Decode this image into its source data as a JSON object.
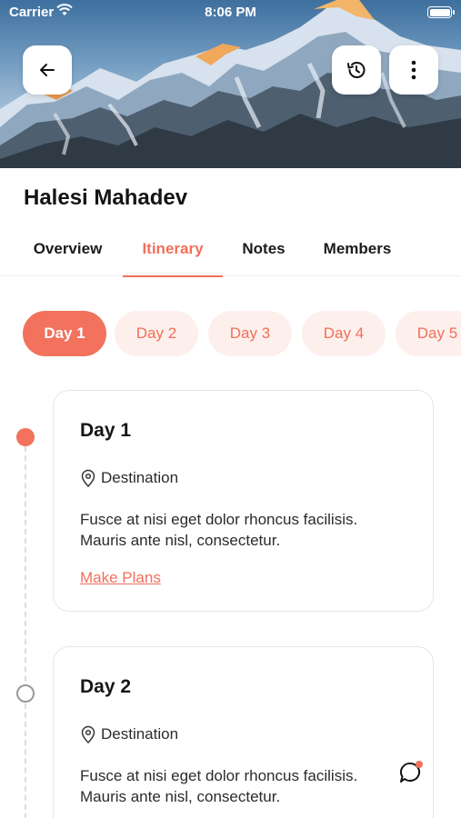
{
  "status_bar": {
    "carrier": "Carrier",
    "time": "8:06 PM"
  },
  "trip": {
    "title": "Halesi Mahadev"
  },
  "tabs": [
    {
      "label": "Overview"
    },
    {
      "label": "Itinerary",
      "active": true
    },
    {
      "label": "Notes"
    },
    {
      "label": "Members"
    }
  ],
  "days": [
    {
      "label": "Day 1",
      "active": true
    },
    {
      "label": "Day 2"
    },
    {
      "label": "Day 3"
    },
    {
      "label": "Day 4"
    },
    {
      "label": "Day 5"
    }
  ],
  "itinerary": [
    {
      "title": "Day 1",
      "destination": "Destination",
      "description": "Fusce at nisi eget dolor rhoncus facilisis. Mauris ante nisl, consectetur.",
      "link": "Make Plans"
    },
    {
      "title": "Day 2",
      "destination": "Destination",
      "description": "Fusce at nisi eget dolor rhoncus facilisis. Mauris ante nisl, consectetur."
    }
  ],
  "icons": {
    "back": "arrow-left-icon",
    "history": "history-icon",
    "more": "more-vertical-icon",
    "location": "location-pin-icon",
    "chat": "chat-bubble-icon"
  },
  "colors": {
    "accent": "#f2725d",
    "chip_bg": "#fdf0ec",
    "border": "#e6e6e6"
  }
}
